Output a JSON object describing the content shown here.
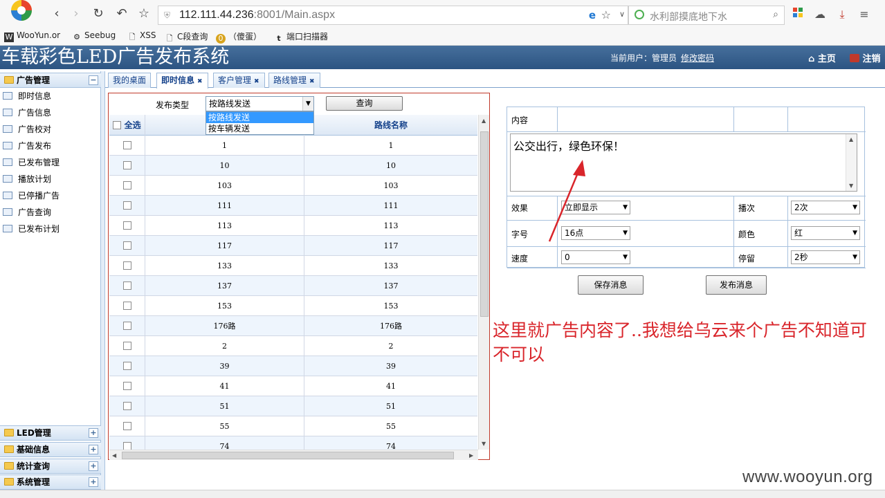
{
  "browser": {
    "url_host": "112.111.44.236",
    "url_rest": ":8001/Main.aspx",
    "search_placeholder": "水利部摸底地下水",
    "bookmarks": [
      "WooYun.or",
      "Seebug",
      "XSS",
      "C段查询",
      "（傻蛋）",
      "端口扫描器"
    ]
  },
  "app": {
    "title": "车载彩色LED广告发布系统",
    "current_user_label": "当前用户：管理员",
    "change_password": "修改密码",
    "home": "主页",
    "logout": "注销"
  },
  "sidebar": {
    "main_group": "广告管理",
    "items": [
      "即时信息",
      "广告信息",
      "广告校对",
      "广告发布",
      "已发布管理",
      "播放计划",
      "已停播广告",
      "广告查询",
      "已发布计划"
    ],
    "groups": [
      "LED管理",
      "基础信息",
      "统计查询",
      "系统管理"
    ]
  },
  "tabs": [
    "我的桌面",
    "即时信息",
    "客户管理",
    "路线管理"
  ],
  "filter": {
    "label": "发布类型",
    "selected": "按路线发送",
    "options": [
      "按路线发送",
      "按车辆发送"
    ],
    "query_button": "查询"
  },
  "grid": {
    "select_all": "全选",
    "column_name": "路线名称",
    "rows": [
      "1",
      "10",
      "103",
      "111",
      "113",
      "117",
      "133",
      "137",
      "153",
      "176路",
      "2",
      "39",
      "41",
      "51",
      "55",
      "74"
    ]
  },
  "form": {
    "content_label": "内容",
    "content_text": "公交出行，绿色环保！",
    "effect_label": "效果",
    "effect_value": "立即显示",
    "count_label": "播次",
    "count_value": "2次",
    "size_label": "字号",
    "size_value": "16点",
    "color_label": "颜色",
    "color_value": "红",
    "speed_label": "速度",
    "speed_value": "0",
    "stay_label": "停留",
    "stay_value": "2秒",
    "save_button": "保存消息",
    "publish_button": "发布消息"
  },
  "annotation": "这里就广告内容了..我想给乌云来个广告不知道可不可以",
  "watermark": "www.wooyun.org",
  "colors": {
    "header": "#2c5482",
    "accent": "#15428b",
    "annotation": "#d9252b"
  }
}
